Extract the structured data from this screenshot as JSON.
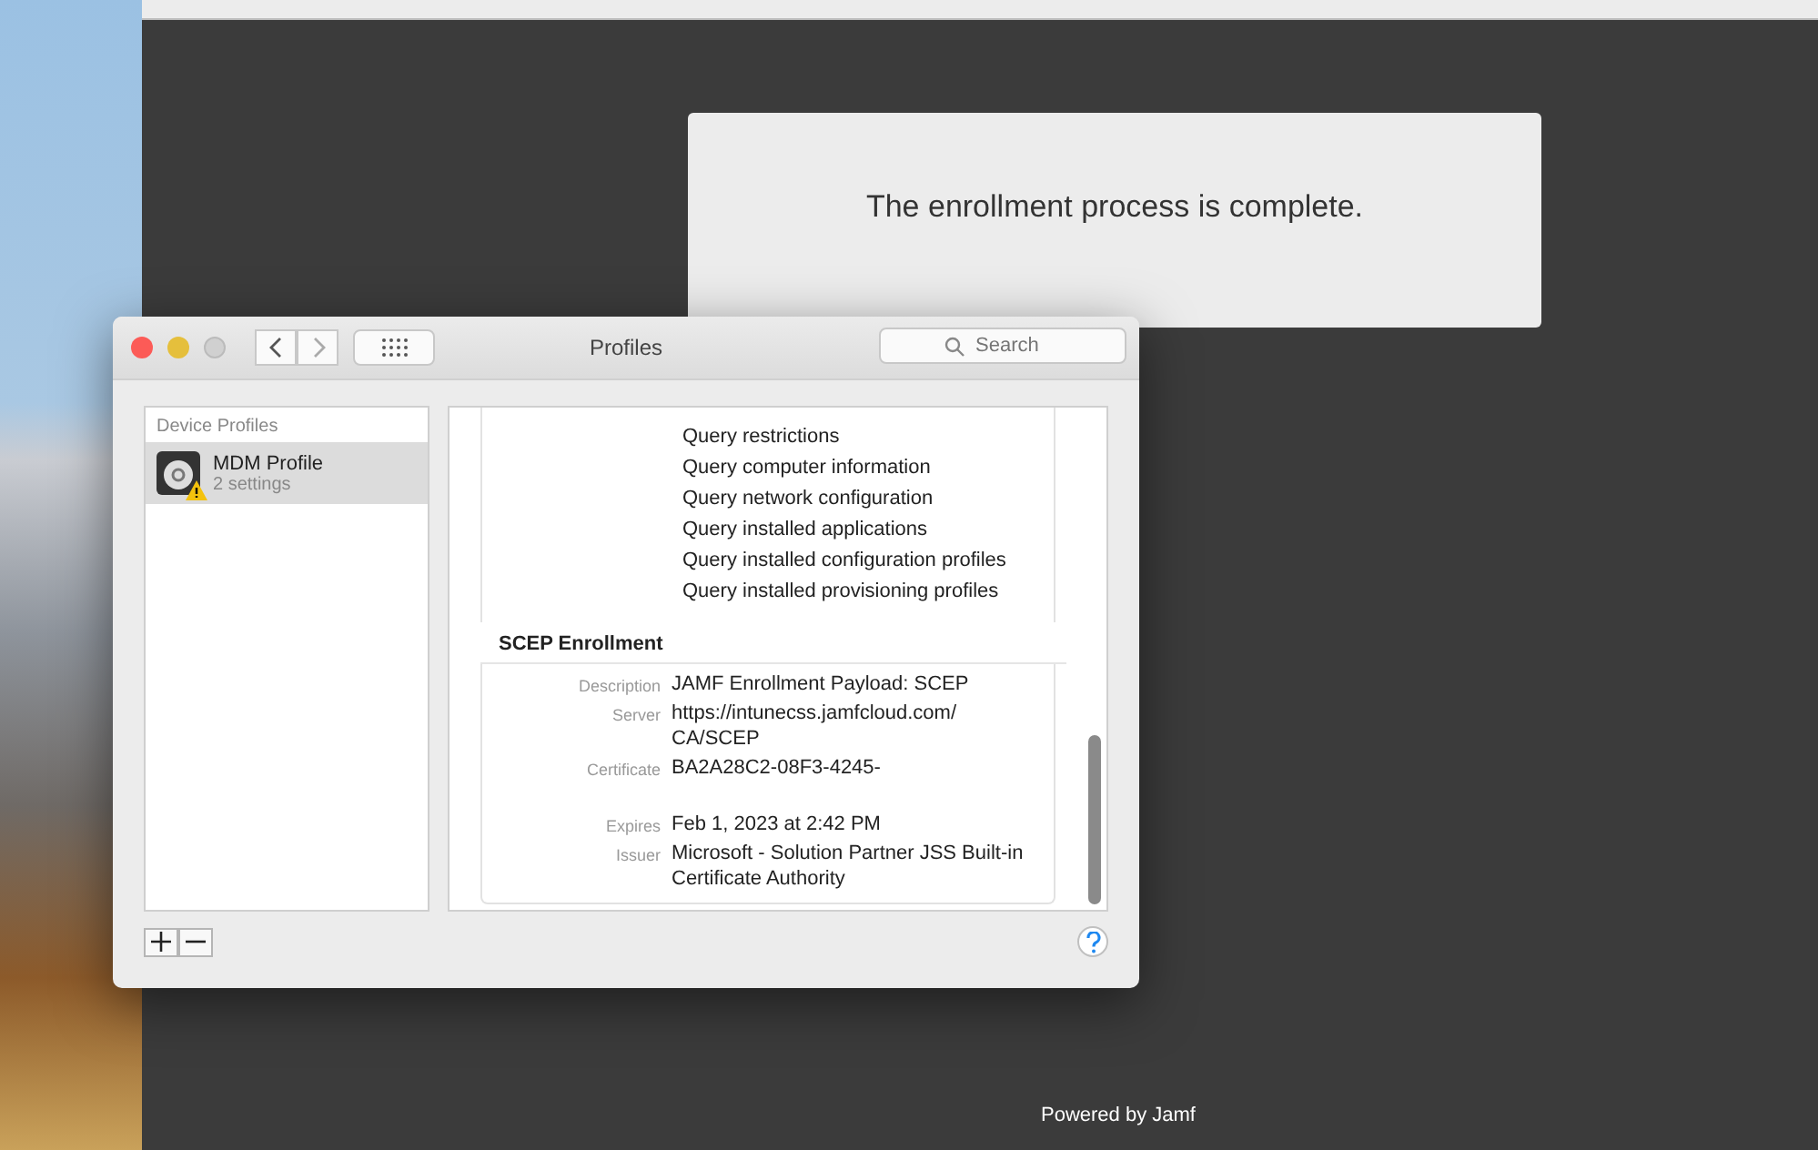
{
  "dialog": {
    "message": "The enrollment process is complete."
  },
  "footer": {
    "text": "Powered by Jamf"
  },
  "window": {
    "title": "Profiles",
    "search": {
      "placeholder": "Search"
    },
    "sidebar": {
      "heading": "Device Profiles",
      "items": [
        {
          "name": "MDM Profile",
          "detail": "2 settings",
          "selected": true,
          "warning": true
        }
      ]
    },
    "details": {
      "query_items": [
        "Query restrictions",
        "Query computer information",
        "Query network configuration",
        "Query installed applications",
        "Query installed configuration profiles",
        "Query installed provisioning profiles"
      ],
      "section": {
        "title": "SCEP Enrollment",
        "fields": [
          {
            "label": "Description",
            "value": "JAMF Enrollment Payload: SCEP"
          },
          {
            "label": "Server",
            "value": "https://intunecss.jamfcloud.com/ CA/SCEP"
          },
          {
            "label": "Certificate",
            "value": "BA2A28C2-08F3-4245-"
          },
          {
            "label": "Expires",
            "value": "Feb 1, 2023 at 2:42 PM"
          },
          {
            "label": "Issuer",
            "value": "Microsoft - Solution Partner JSS Built-in Certificate Authority"
          }
        ]
      }
    }
  }
}
